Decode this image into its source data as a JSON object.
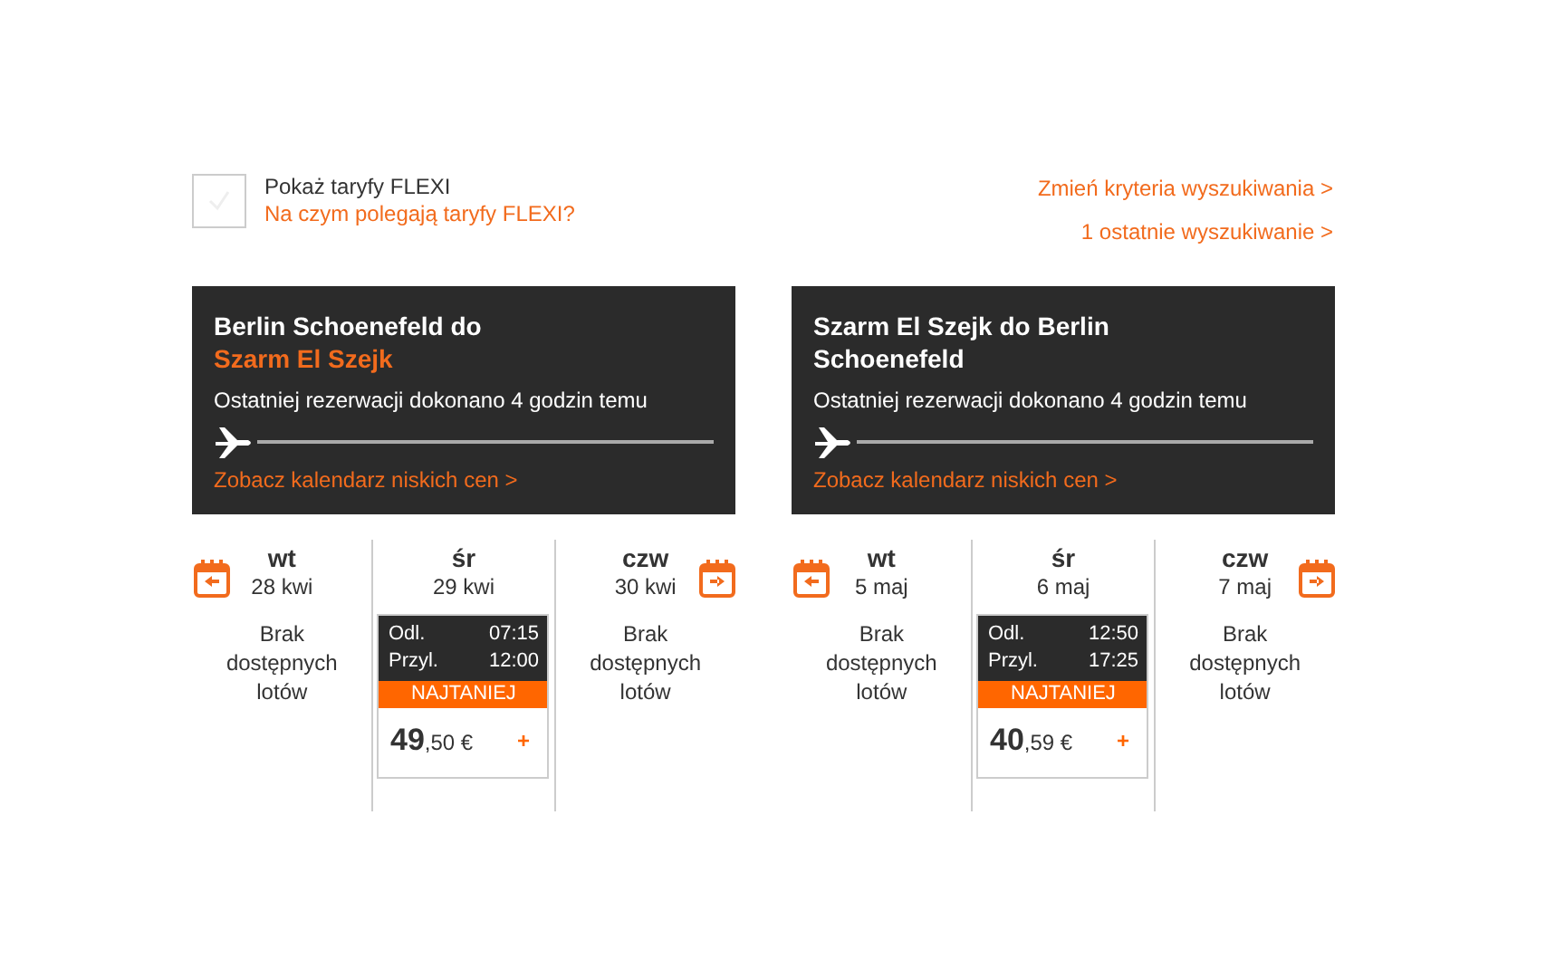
{
  "flexi": {
    "label": "Pokaż taryfy FLEXI",
    "checked": false,
    "info_link": "Na czym polegają taryfy FLEXI?"
  },
  "links": [
    "Zmień kryteria wyszukiwania >",
    "1 ostatnie wyszukiwanie >"
  ],
  "journeys": [
    {
      "title_lines": [
        {
          "text": "Berlin Schoenefeld do",
          "highlighted": false
        },
        {
          "text": "Szarm El Szejk",
          "highlighted": true
        }
      ],
      "info": "Ostatniej rezerwacji dokonano 4 godzin temu",
      "calendar_link": "Zobacz kalendarz niskich cen >",
      "days": [
        {
          "kind": "empty",
          "weekday": "wt",
          "date": "28 kwi",
          "message": "Brak dostępnych lotów"
        },
        {
          "kind": "flight",
          "weekday": "śr",
          "date": "29 kwi",
          "departure_label": "Odl.",
          "departure_time": "07:15",
          "arrival_label": "Przyl.",
          "arrival_time": "12:00",
          "badge": "NAJTANIEJ",
          "price_whole": "49",
          "price_rest": ",50 €",
          "add": "+"
        },
        {
          "kind": "empty",
          "weekday": "czw",
          "date": "30 kwi",
          "message": "Brak dostępnych lotów"
        }
      ]
    },
    {
      "title_lines": [
        {
          "text": "Szarm El Szejk do Berlin Schoenefeld",
          "highlighted": false
        }
      ],
      "info": "Ostatniej rezerwacji dokonano 4 godzin temu",
      "calendar_link": "Zobacz kalendarz niskich cen >",
      "days": [
        {
          "kind": "empty",
          "weekday": "wt",
          "date": "5 maj",
          "message": "Brak dostępnych lotów"
        },
        {
          "kind": "flight",
          "weekday": "śr",
          "date": "6 maj",
          "departure_label": "Odl.",
          "departure_time": "12:50",
          "arrival_label": "Przyl.",
          "arrival_time": "17:25",
          "badge": "NAJTANIEJ",
          "price_whole": "40",
          "price_rest": ",59 €",
          "add": "+"
        },
        {
          "kind": "empty",
          "weekday": "czw",
          "date": "7 maj",
          "message": "Brak dostępnych lotów"
        }
      ]
    }
  ]
}
